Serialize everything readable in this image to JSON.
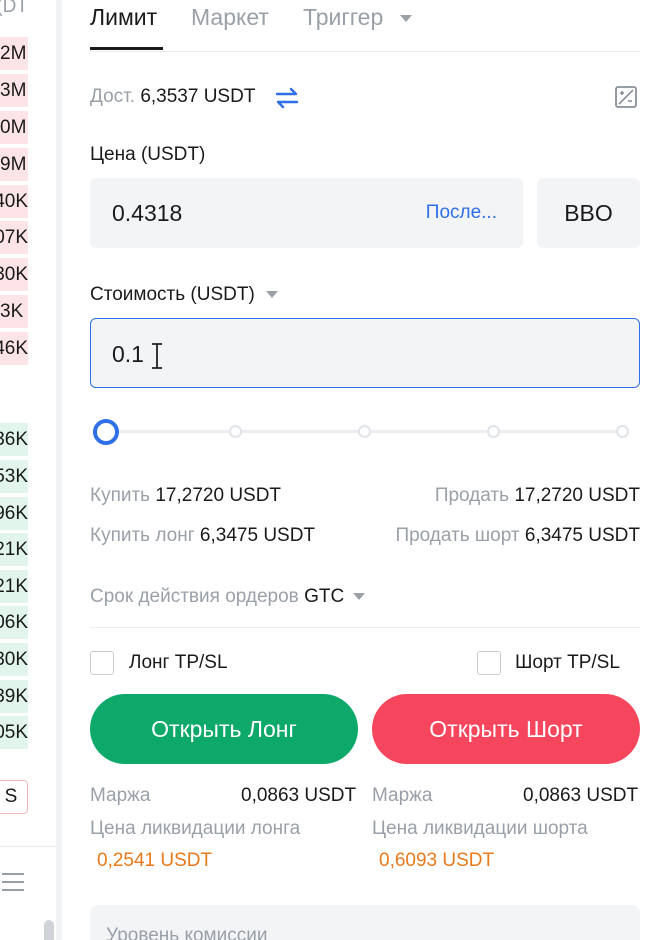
{
  "orderbook": {
    "header": "DT)",
    "asks": [
      "2M",
      "3M",
      "0M",
      "9M",
      "40K",
      "07K",
      "30K",
      "3K",
      "46K"
    ],
    "bids": [
      "36K",
      "53K",
      "96K",
      "21K",
      "21K",
      "06K",
      "30K",
      "39K",
      "05K"
    ],
    "side_button": "S"
  },
  "tabs": [
    {
      "label": "Лимит",
      "active": true
    },
    {
      "label": "Маркет",
      "active": false
    },
    {
      "label": "Триггер",
      "active": false
    }
  ],
  "available": {
    "label": "Дост.",
    "value": "6,3537 USDT"
  },
  "price": {
    "label": "Цена (USDT)",
    "value": "0.4318",
    "link": "После...",
    "bbo": "BBO"
  },
  "cost": {
    "label": "Стоимость (USDT)",
    "value": "0.1"
  },
  "slider": {
    "percent": 0
  },
  "buy": {
    "label": "Купить",
    "value": "17,2720 USDT"
  },
  "sell": {
    "label": "Продать",
    "value": "17,2720 USDT"
  },
  "buy_long": {
    "label": "Купить лонг",
    "value": "6,3475 USDT"
  },
  "sell_short": {
    "label": "Продать шорт",
    "value": "6,3475 USDT"
  },
  "order_validity": {
    "label": "Срок действия ордеров",
    "value": "GTC"
  },
  "long_tpsl": "Лонг TP/SL",
  "short_tpsl": "Шорт TP/SL",
  "open_long": "Открыть Лонг",
  "open_short": "Открыть Шорт",
  "long_info": {
    "margin_label": "Маржа",
    "margin_value": "0,0863 USDT",
    "liq_label": "Цена ликвидации лонга",
    "liq_value": "0,2541 USDT"
  },
  "short_info": {
    "margin_label": "Маржа",
    "margin_value": "0,0863 USDT",
    "liq_label": "Цена ликвидации шорта",
    "liq_value": "0,6093 USDT"
  },
  "fee_level": "Уровень комиссии",
  "colors": {
    "accent": "#2f6fe8",
    "long": "#0ca96a",
    "short": "#f6465d",
    "liq": "#e87a1a"
  }
}
